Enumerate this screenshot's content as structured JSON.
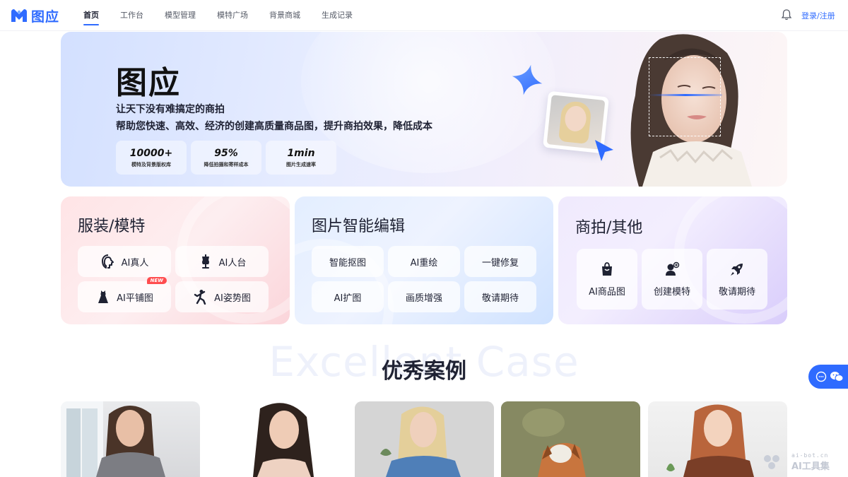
{
  "brand": {
    "name": "图应",
    "color": "#2f6bff"
  },
  "nav": {
    "items": [
      {
        "label": "首页",
        "active": true
      },
      {
        "label": "工作台",
        "active": false
      },
      {
        "label": "模型管理",
        "active": false
      },
      {
        "label": "模特广场",
        "active": false
      },
      {
        "label": "背景商城",
        "active": false
      },
      {
        "label": "生成记录",
        "active": false
      }
    ],
    "bell_icon": "bell-icon",
    "login": "登录/注册"
  },
  "hero": {
    "title": "图应",
    "subtitle1": "让天下没有难搞定的商拍",
    "subtitle2": "帮助您快速、高效、经济的创建高质量商品图，提升商拍效果，降低成本",
    "stats": [
      {
        "value": "10000+",
        "label": "模特及背景版权库"
      },
      {
        "value": "95%",
        "label": "降低拍摄和寄样成本"
      },
      {
        "value": "1min",
        "label": "图片生成速率"
      }
    ]
  },
  "cards": {
    "apparel": {
      "title": "服装/模特",
      "chips": [
        {
          "label": "AI真人",
          "icon": "model-face-icon"
        },
        {
          "label": "AI人台",
          "icon": "mannequin-icon"
        },
        {
          "label": "AI平铺图",
          "icon": "dress-icon",
          "badge": "NEW"
        },
        {
          "label": "AI姿势图",
          "icon": "pose-icon"
        }
      ]
    },
    "edit": {
      "title": "图片智能编辑",
      "chips": [
        {
          "label": "智能抠图"
        },
        {
          "label": "AI重绘"
        },
        {
          "label": "一键修复"
        },
        {
          "label": "AI扩图"
        },
        {
          "label": "画质增强"
        },
        {
          "label": "敬请期待"
        }
      ]
    },
    "product": {
      "title": "商拍/其他",
      "tiles": [
        {
          "label": "AI商品图",
          "icon": "shopping-bag-icon"
        },
        {
          "label": "创建模特",
          "icon": "add-person-icon"
        },
        {
          "label": "敬请期待",
          "icon": "rocket-icon"
        }
      ]
    }
  },
  "section": {
    "bg_text": "Excellent Case",
    "title": "优秀案例"
  },
  "float_chat": {
    "icons": [
      "chat-bubble-icon",
      "wechat-icon"
    ]
  },
  "watermark": {
    "line1": "ai-bot.cn",
    "line2": "AI工具集"
  }
}
